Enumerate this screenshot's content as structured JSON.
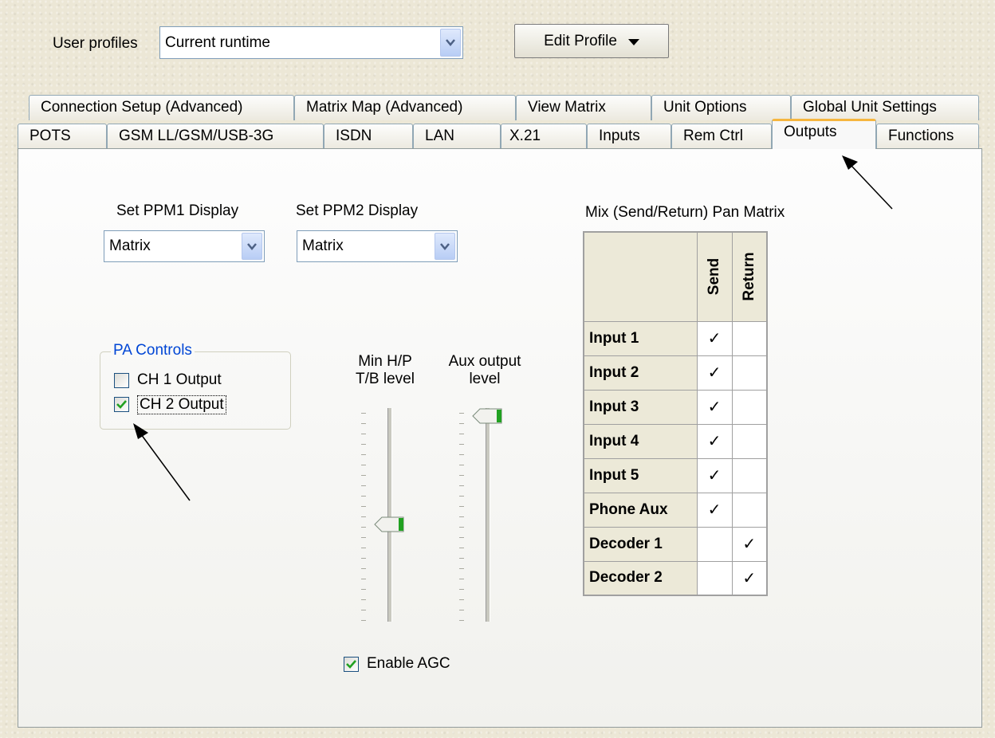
{
  "header": {
    "profiles_label": "User profiles",
    "profile_value": "Current runtime",
    "edit_profile_label": "Edit Profile"
  },
  "tabs_row1": [
    "Connection Setup (Advanced)",
    "Matrix Map (Advanced)",
    "View Matrix",
    "Unit Options",
    "Global Unit Settings"
  ],
  "tabs_row2": [
    "POTS",
    "GSM LL/GSM/USB-3G",
    "ISDN",
    "LAN",
    "X.21",
    "Inputs",
    "Rem Ctrl",
    "Outputs",
    "Functions"
  ],
  "active_tab": "Outputs",
  "ppm1": {
    "label": "Set PPM1 Display",
    "value": "Matrix"
  },
  "ppm2": {
    "label": "Set PPM2 Display",
    "value": "Matrix"
  },
  "pa_controls": {
    "title": "PA Controls",
    "ch1": {
      "label": "CH 1 Output",
      "checked": false
    },
    "ch2": {
      "label": "CH 2 Output",
      "checked": true
    }
  },
  "sliders": {
    "min_hp": {
      "label_line1": "Min H/P",
      "label_line2": "T/B level",
      "level": 0.45
    },
    "aux": {
      "label_line1": "Aux output",
      "label_line2": "level",
      "level": 1.0
    }
  },
  "enable_agc": {
    "label": "Enable AGC",
    "checked": true
  },
  "matrix": {
    "title": "Mix (Send/Return) Pan Matrix",
    "columns": [
      "Send",
      "Return"
    ],
    "rows": [
      {
        "name": "Input 1",
        "send": "✓",
        "return": ""
      },
      {
        "name": "Input 2",
        "send": "✓",
        "return": ""
      },
      {
        "name": "Input 3",
        "send": "✓",
        "return": ""
      },
      {
        "name": "Input 4",
        "send": "✓",
        "return": ""
      },
      {
        "name": "Input 5",
        "send": "✓",
        "return": ""
      },
      {
        "name": "Phone Aux",
        "send": "✓",
        "return": ""
      },
      {
        "name": "Decoder 1",
        "send": "",
        "return": "✓"
      },
      {
        "name": "Decoder 2",
        "send": "",
        "return": "✓"
      }
    ]
  },
  "colors": {
    "accent_tab": "#f6b63f",
    "group_title": "#0046d5",
    "check_green": "#21a121"
  }
}
